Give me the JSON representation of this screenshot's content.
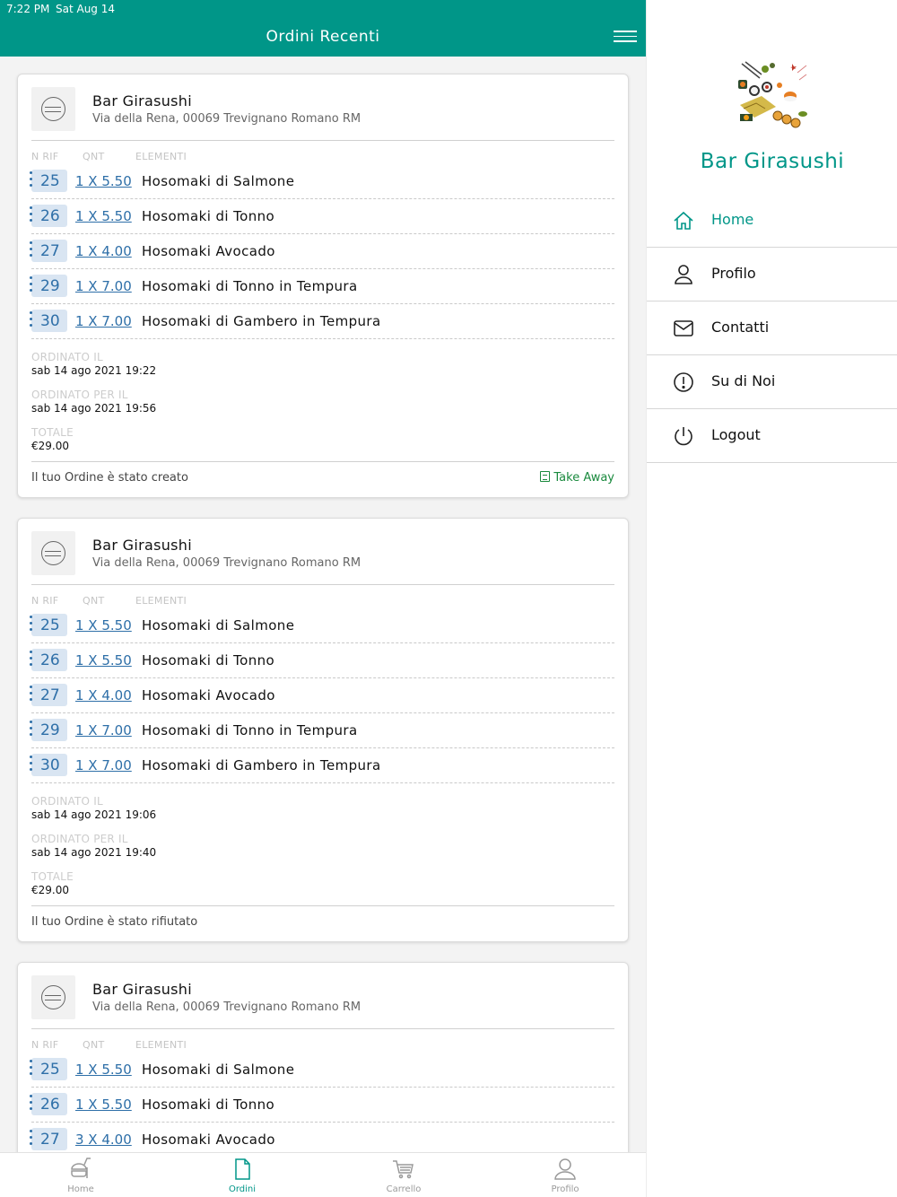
{
  "status_bar": {
    "time": "7:22 PM",
    "date": "Sat Aug 14"
  },
  "header": {
    "title": "Ordini Recenti",
    "menu_icon": "hamburger-icon"
  },
  "column_headers": {
    "rif": "N RIF",
    "qnt": "QNT",
    "elementi": "ELEMENTI"
  },
  "meta_labels": {
    "ordinato_il": "ORDINATO IL",
    "ordinato_per": "ORDINATO PER IL",
    "totale": "TOTALE"
  },
  "orders": [
    {
      "shop_name": "Bar Girasushi",
      "shop_address": "Via della Rena, 00069 Trevignano Romano RM",
      "items": [
        {
          "rif": "25",
          "qnt": "1 X 5.50",
          "name": "Hosomaki di Salmone"
        },
        {
          "rif": "26",
          "qnt": "1 X 5.50",
          "name": "Hosomaki di Tonno"
        },
        {
          "rif": "27",
          "qnt": "1 X 4.00",
          "name": "Hosomaki Avocado"
        },
        {
          "rif": "29",
          "qnt": "1 X 7.00",
          "name": "Hosomaki di Tonno in Tempura"
        },
        {
          "rif": "30",
          "qnt": "1 X 7.00",
          "name": "Hosomaki di Gambero in Tempura"
        }
      ],
      "ordinato_il": "sab 14 ago 2021 19:22",
      "ordinato_per": "sab 14 ago 2021 19:56",
      "totale": "€29.00",
      "status": "Il tuo Ordine è stato creato",
      "delivery_type": "Take Away"
    },
    {
      "shop_name": "Bar Girasushi",
      "shop_address": "Via della Rena, 00069 Trevignano Romano RM",
      "items": [
        {
          "rif": "25",
          "qnt": "1 X 5.50",
          "name": "Hosomaki di Salmone"
        },
        {
          "rif": "26",
          "qnt": "1 X 5.50",
          "name": "Hosomaki di Tonno"
        },
        {
          "rif": "27",
          "qnt": "1 X 4.00",
          "name": "Hosomaki Avocado"
        },
        {
          "rif": "29",
          "qnt": "1 X 7.00",
          "name": "Hosomaki di Tonno in Tempura"
        },
        {
          "rif": "30",
          "qnt": "1 X 7.00",
          "name": "Hosomaki di Gambero in Tempura"
        }
      ],
      "ordinato_il": "sab 14 ago 2021 19:06",
      "ordinato_per": "sab 14 ago 2021 19:40",
      "totale": "€29.00",
      "status": "Il tuo Ordine è stato rifiutato"
    },
    {
      "shop_name": "Bar Girasushi",
      "shop_address": "Via della Rena, 00069 Trevignano Romano RM",
      "items": [
        {
          "rif": "25",
          "qnt": "1 X 5.50",
          "name": "Hosomaki di Salmone"
        },
        {
          "rif": "26",
          "qnt": "1 X 5.50",
          "name": "Hosomaki di Tonno"
        },
        {
          "rif": "27",
          "qnt": "3 X 4.00",
          "name": "Hosomaki Avocado"
        }
      ]
    }
  ],
  "tabbar": [
    {
      "label": "Home",
      "icon": "burger-drink-icon",
      "active": false
    },
    {
      "label": "Ordini",
      "icon": "document-icon",
      "active": true
    },
    {
      "label": "Carrello",
      "icon": "cart-icon",
      "active": false
    },
    {
      "label": "Profilo",
      "icon": "user-icon",
      "active": false
    }
  ],
  "drawer": {
    "title": "Bar Girasushi",
    "items": [
      {
        "label": "Home",
        "icon": "home-icon",
        "active": true
      },
      {
        "label": "Profilo",
        "icon": "user-icon",
        "active": false
      },
      {
        "label": "Contatti",
        "icon": "mail-icon",
        "active": false
      },
      {
        "label": "Su di Noi",
        "icon": "info-icon",
        "active": false
      },
      {
        "label": "Logout",
        "icon": "power-icon",
        "active": false
      }
    ]
  },
  "colors": {
    "primary": "#009688",
    "link": "#2e6fa8",
    "badge_bg": "#d9e5f2",
    "takeaway": "#1a8a3e"
  }
}
